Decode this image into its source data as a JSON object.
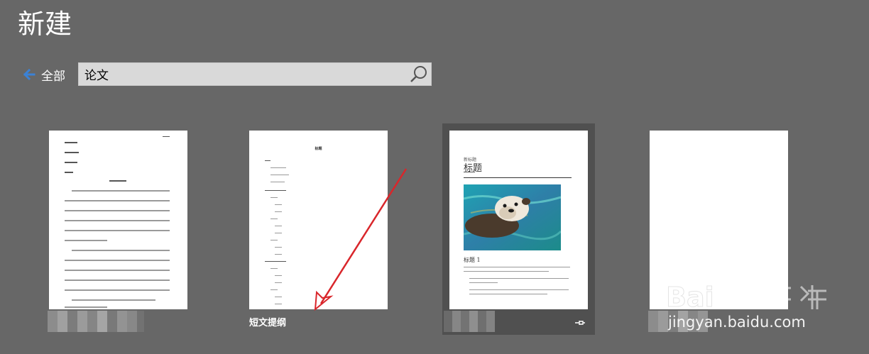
{
  "header": {
    "title": "新建"
  },
  "nav": {
    "back_label": "全部"
  },
  "search": {
    "value": "论文",
    "placeholder": ""
  },
  "templates": [
    {
      "label": "",
      "thumbnail": "apa-paper"
    },
    {
      "label": "短文提纲",
      "thumbnail": "outline"
    },
    {
      "label": "",
      "thumbnail": "blog-post",
      "selected": true,
      "pin_icon": "pin-icon"
    },
    {
      "label": "",
      "thumbnail": "blank"
    }
  ],
  "thumbnails": {
    "outline": {
      "title": "标题"
    },
    "blog": {
      "eyebrow": "新标题",
      "title": "标题",
      "h1": "标题 1"
    }
  },
  "watermark": {
    "text": "jingyan.baidu.com"
  },
  "colors": {
    "background": "#676767",
    "search_bg": "#d9d9d9",
    "selected_card": "#505050",
    "back_arrow": "#3b82d6",
    "annotation": "#d9262b"
  },
  "icons": {
    "back": "arrow-left-icon",
    "search": "search-icon",
    "pin": "pin-icon"
  }
}
